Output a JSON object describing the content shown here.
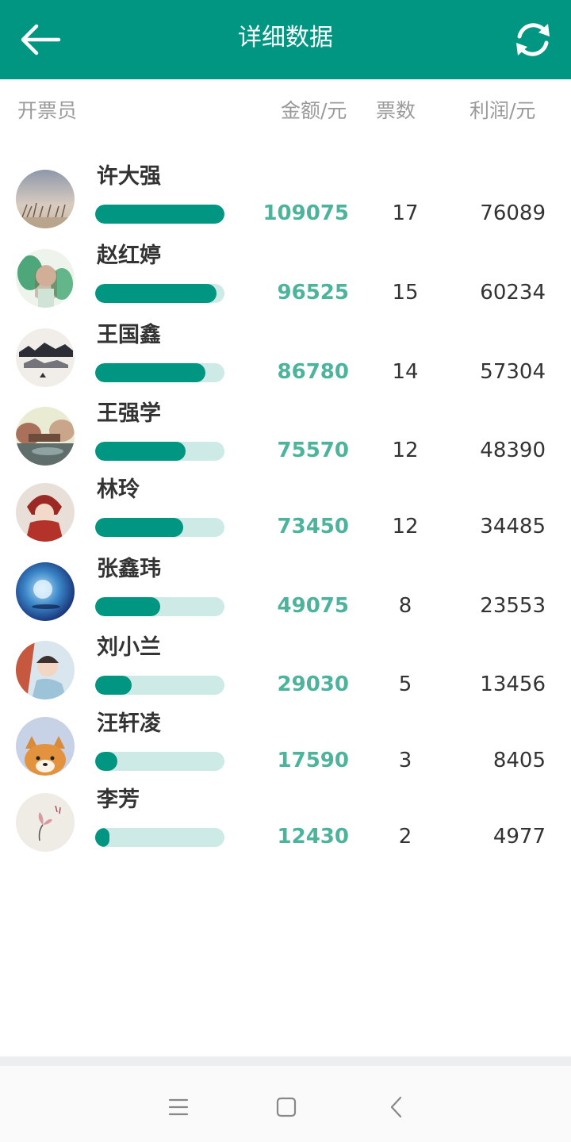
{
  "header": {
    "title": "详细数据",
    "back_icon": "arrow-left-icon",
    "refresh_icon": "refresh-icon",
    "accent_color": "#009682"
  },
  "columns": {
    "seller": "开票员",
    "amount": "金额/元",
    "tickets": "票数",
    "profit": "利润/元"
  },
  "rows": [
    {
      "name": "许大强",
      "amount": "109075",
      "tickets": "17",
      "profit": "76089",
      "bar_fill": 1.0
    },
    {
      "name": "赵红婷",
      "amount": "96525",
      "tickets": "15",
      "profit": "60234",
      "bar_fill": 0.94
    },
    {
      "name": "王国鑫",
      "amount": "86780",
      "tickets": "14",
      "profit": "57304",
      "bar_fill": 0.85
    },
    {
      "name": "王强学",
      "amount": "75570",
      "tickets": "12",
      "profit": "48390",
      "bar_fill": 0.7
    },
    {
      "name": "林玲",
      "amount": "73450",
      "tickets": "12",
      "profit": "34485",
      "bar_fill": 0.68
    },
    {
      "name": "张鑫玮",
      "amount": "49075",
      "tickets": "8",
      "profit": "23553",
      "bar_fill": 0.5
    },
    {
      "name": "刘小兰",
      "amount": "29030",
      "tickets": "5",
      "profit": "13456",
      "bar_fill": 0.28
    },
    {
      "name": "汪轩凌",
      "amount": "17590",
      "tickets": "3",
      "profit": "8405",
      "bar_fill": 0.17
    },
    {
      "name": "李芳",
      "amount": "12430",
      "tickets": "2",
      "profit": "4977",
      "bar_fill": 0.11
    }
  ],
  "navbar": {
    "menu_icon": "menu-icon",
    "home_icon": "home-square-icon",
    "back_icon": "chevron-left-icon"
  }
}
